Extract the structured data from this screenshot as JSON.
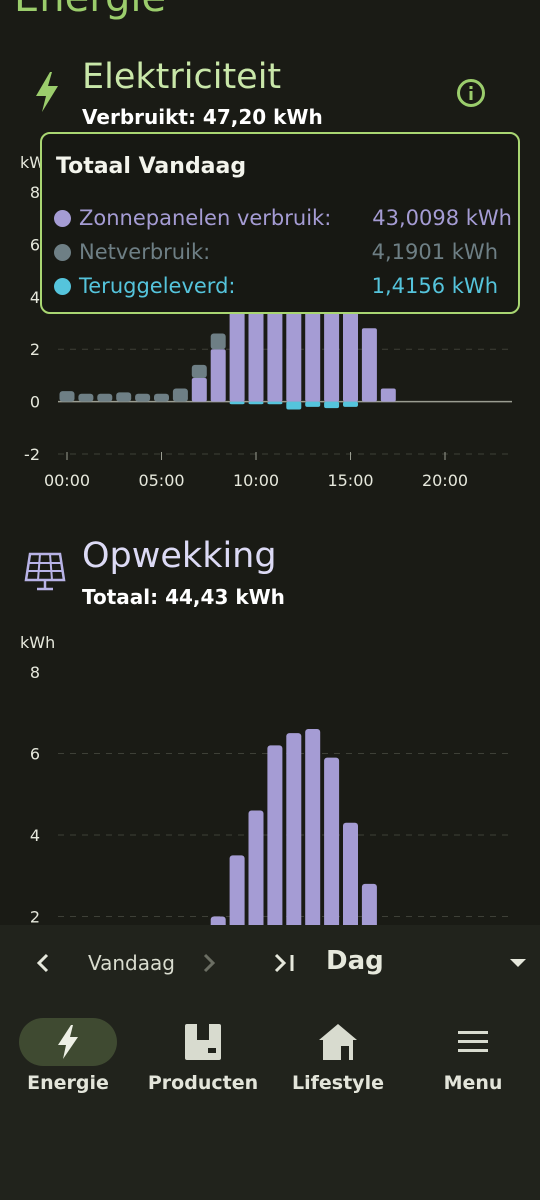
{
  "page": {
    "title": "Energie"
  },
  "electricity": {
    "title": "Elektriciteit",
    "subtitle": "Verbruikt: 47,20 kWh",
    "unit": "kWh",
    "tooltip": {
      "title": "Totaal Vandaag",
      "rows": [
        {
          "label": "Zonnepanelen verbruik:",
          "value": "43,0098 kWh",
          "color": "#a59cd4"
        },
        {
          "label": "Netverbruik:",
          "value": "4,1901 kWh",
          "color": "#6e7f85"
        },
        {
          "label": "Teruggeleverd:",
          "value": "1,4156 kWh",
          "color": "#55c4dc"
        }
      ]
    }
  },
  "generation": {
    "title": "Opwekking",
    "subtitle": "Totaal: 44,43 kWh",
    "unit": "kWh"
  },
  "controls": {
    "prev_icon": "chevron-left-icon",
    "period_label": "Vandaag",
    "next_icon": "chevron-right-icon",
    "skip_icon": "skip-to-end-icon",
    "granularity": "Dag",
    "dropdown_icon": "caret-down-icon"
  },
  "nav": [
    {
      "label": "Energie",
      "icon": "bolt-icon",
      "active": true
    },
    {
      "label": "Producten",
      "icon": "box-icon",
      "active": false
    },
    {
      "label": "Lifestyle",
      "icon": "house-icon",
      "active": false
    },
    {
      "label": "Menu",
      "icon": "menu-icon",
      "active": false
    }
  ],
  "colors": {
    "accent_green": "#9bcd6c",
    "solar": "#a59cd4",
    "grid": "#6e7f85",
    "return": "#55c4dc",
    "background": "#1a1b15"
  },
  "chart_data": [
    {
      "type": "bar",
      "title": "Elektriciteit",
      "ylabel": "kWh",
      "ylim": [
        -2,
        8
      ],
      "yticks": [
        -2,
        0,
        2,
        4,
        6,
        8
      ],
      "xticks": [
        "00:00",
        "05:00",
        "10:00",
        "15:00",
        "20:00"
      ],
      "x": [
        0,
        1,
        2,
        3,
        4,
        5,
        6,
        7,
        8,
        9,
        10,
        11,
        12,
        13,
        14,
        15,
        16,
        17,
        18,
        19,
        20,
        21,
        22,
        23
      ],
      "series": [
        {
          "name": "Zonnepanelen verbruik",
          "values": [
            0,
            0,
            0,
            0,
            0,
            0,
            0,
            0.9,
            2.0,
            3.5,
            4.5,
            6.1,
            6.4,
            6.5,
            5.8,
            4.2,
            2.8,
            0.5,
            0,
            0,
            0,
            0,
            0,
            0
          ]
        },
        {
          "name": "Netverbruik",
          "values": [
            0.4,
            0.3,
            0.3,
            0.35,
            0.3,
            0.3,
            0.5,
            0.5,
            0.6,
            0,
            0,
            0,
            0,
            0,
            0,
            0,
            0,
            0,
            0,
            0,
            0,
            0,
            0,
            0
          ]
        },
        {
          "name": "Teruggeleverd",
          "values": [
            0,
            0,
            0,
            0,
            0,
            0,
            0,
            0,
            0,
            -0.1,
            -0.1,
            -0.1,
            -0.3,
            -0.2,
            -0.25,
            -0.2,
            0,
            0,
            0,
            0,
            0,
            0,
            0,
            0
          ]
        }
      ]
    },
    {
      "type": "bar",
      "title": "Opwekking",
      "ylabel": "kWh",
      "ylim": [
        0,
        8
      ],
      "yticks": [
        2,
        4,
        6,
        8
      ],
      "x": [
        0,
        1,
        2,
        3,
        4,
        5,
        6,
        7,
        8,
        9,
        10,
        11,
        12,
        13,
        14,
        15,
        16,
        17,
        18,
        19,
        20,
        21,
        22,
        23
      ],
      "series": [
        {
          "name": "Opwekking",
          "values": [
            0,
            0,
            0,
            0,
            0,
            0,
            0,
            1.0,
            2.0,
            3.5,
            4.6,
            6.2,
            6.5,
            6.6,
            5.9,
            4.3,
            2.8,
            0.5,
            0,
            0,
            0,
            0,
            0,
            0
          ]
        }
      ]
    }
  ]
}
